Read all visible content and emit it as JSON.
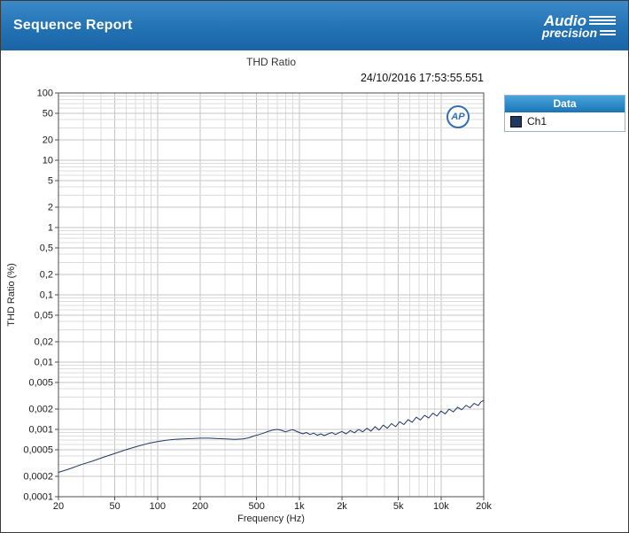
{
  "header": {
    "title": "Sequence Report",
    "logo": {
      "line1": "Audio",
      "line2": "precision"
    }
  },
  "legend": {
    "header": "Data",
    "items": [
      {
        "label": "Ch1",
        "color": "#1f3864"
      }
    ]
  },
  "chart_data": {
    "type": "line",
    "title": "THD Ratio",
    "timestamp": "24/10/2016 17:53:55.551",
    "xlabel": "Frequency (Hz)",
    "ylabel": "THD Ratio (%)",
    "badge": "AP",
    "x_scale": "log",
    "y_scale": "log",
    "xlim": [
      20,
      20000
    ],
    "ylim": [
      0.0001,
      100
    ],
    "grid": true,
    "legend_position": "right",
    "x_ticks": [
      {
        "v": 20,
        "label": "20"
      },
      {
        "v": 50,
        "label": "50"
      },
      {
        "v": 100,
        "label": "100"
      },
      {
        "v": 200,
        "label": "200"
      },
      {
        "v": 500,
        "label": "500"
      },
      {
        "v": 1000,
        "label": "1k"
      },
      {
        "v": 2000,
        "label": "2k"
      },
      {
        "v": 5000,
        "label": "5k"
      },
      {
        "v": 10000,
        "label": "10k"
      },
      {
        "v": 20000,
        "label": "20k"
      }
    ],
    "y_ticks": [
      {
        "v": 100,
        "label": "100"
      },
      {
        "v": 50,
        "label": "50"
      },
      {
        "v": 20,
        "label": "20"
      },
      {
        "v": 10,
        "label": "10"
      },
      {
        "v": 5,
        "label": "5"
      },
      {
        "v": 2,
        "label": "2"
      },
      {
        "v": 1,
        "label": "1"
      },
      {
        "v": 0.5,
        "label": "0,5"
      },
      {
        "v": 0.2,
        "label": "0,2"
      },
      {
        "v": 0.1,
        "label": "0,1"
      },
      {
        "v": 0.05,
        "label": "0,05"
      },
      {
        "v": 0.02,
        "label": "0,02"
      },
      {
        "v": 0.01,
        "label": "0,01"
      },
      {
        "v": 0.005,
        "label": "0,005"
      },
      {
        "v": 0.002,
        "label": "0,002"
      },
      {
        "v": 0.001,
        "label": "0,001"
      },
      {
        "v": 0.0005,
        "label": "0,0005"
      },
      {
        "v": 0.0002,
        "label": "0,0002"
      },
      {
        "v": 0.0001,
        "label": "0,0001"
      }
    ],
    "series": [
      {
        "name": "Ch1",
        "color": "#1f3864",
        "points": [
          [
            20,
            0.00023
          ],
          [
            24,
            0.00026
          ],
          [
            29,
            0.0003
          ],
          [
            35,
            0.00034
          ],
          [
            42,
            0.00039
          ],
          [
            50,
            0.00044
          ],
          [
            60,
            0.0005
          ],
          [
            72,
            0.00056
          ],
          [
            86,
            0.00062
          ],
          [
            100,
            0.00066
          ],
          [
            115,
            0.00069
          ],
          [
            132,
            0.00071
          ],
          [
            152,
            0.00072
          ],
          [
            175,
            0.00073
          ],
          [
            200,
            0.00074
          ],
          [
            230,
            0.00074
          ],
          [
            264,
            0.00073
          ],
          [
            304,
            0.00072
          ],
          [
            350,
            0.00071
          ],
          [
            400,
            0.00072
          ],
          [
            440,
            0.00075
          ],
          [
            480,
            0.0008
          ],
          [
            520,
            0.00084
          ],
          [
            560,
            0.00088
          ],
          [
            600,
            0.00093
          ],
          [
            650,
            0.00098
          ],
          [
            700,
            0.001
          ],
          [
            750,
            0.00097
          ],
          [
            800,
            0.00092
          ],
          [
            850,
            0.00096
          ],
          [
            900,
            0.00099
          ],
          [
            950,
            0.00094
          ],
          [
            1000,
            0.0009
          ],
          [
            1060,
            0.00086
          ],
          [
            1120,
            0.0009
          ],
          [
            1190,
            0.00084
          ],
          [
            1260,
            0.00088
          ],
          [
            1340,
            0.00082
          ],
          [
            1420,
            0.00086
          ],
          [
            1500,
            0.00081
          ],
          [
            1600,
            0.00086
          ],
          [
            1700,
            0.0009
          ],
          [
            1800,
            0.00084
          ],
          [
            1900,
            0.00089
          ],
          [
            2000,
            0.00093
          ],
          [
            2140,
            0.00086
          ],
          [
            2290,
            0.00096
          ],
          [
            2450,
            0.00089
          ],
          [
            2620,
            0.001
          ],
          [
            2800,
            0.00092
          ],
          [
            3000,
            0.00104
          ],
          [
            3200,
            0.00094
          ],
          [
            3420,
            0.0011
          ],
          [
            3660,
            0.00098
          ],
          [
            3910,
            0.00116
          ],
          [
            4180,
            0.00104
          ],
          [
            4470,
            0.00122
          ],
          [
            4780,
            0.0011
          ],
          [
            5110,
            0.0013
          ],
          [
            5470,
            0.00118
          ],
          [
            5850,
            0.0014
          ],
          [
            6250,
            0.00128
          ],
          [
            6690,
            0.00152
          ],
          [
            7150,
            0.00138
          ],
          [
            7650,
            0.00162
          ],
          [
            8180,
            0.00148
          ],
          [
            8750,
            0.00174
          ],
          [
            9360,
            0.00158
          ],
          [
            10000,
            0.00188
          ],
          [
            10700,
            0.0017
          ],
          [
            11400,
            0.002
          ],
          [
            12200,
            0.00182
          ],
          [
            13100,
            0.00214
          ],
          [
            14000,
            0.00196
          ],
          [
            15000,
            0.00228
          ],
          [
            16000,
            0.0021
          ],
          [
            17100,
            0.00244
          ],
          [
            18300,
            0.00226
          ],
          [
            19100,
            0.00256
          ],
          [
            20000,
            0.0027
          ]
        ]
      }
    ]
  }
}
